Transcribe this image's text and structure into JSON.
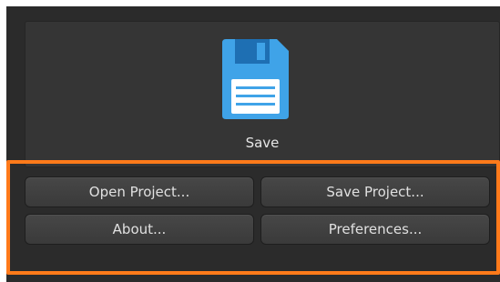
{
  "save_tile": {
    "label": "Save",
    "icon": "floppy-disk-icon",
    "icon_color": "#3fa3e8"
  },
  "actions": {
    "open_project": "Open Project...",
    "save_project": "Save Project...",
    "about": "About...",
    "preferences": "Preferences..."
  },
  "colors": {
    "panel_bg": "#2b2b2b",
    "highlight_border": "#ff7a1a",
    "button_text": "#e0e0e0"
  }
}
